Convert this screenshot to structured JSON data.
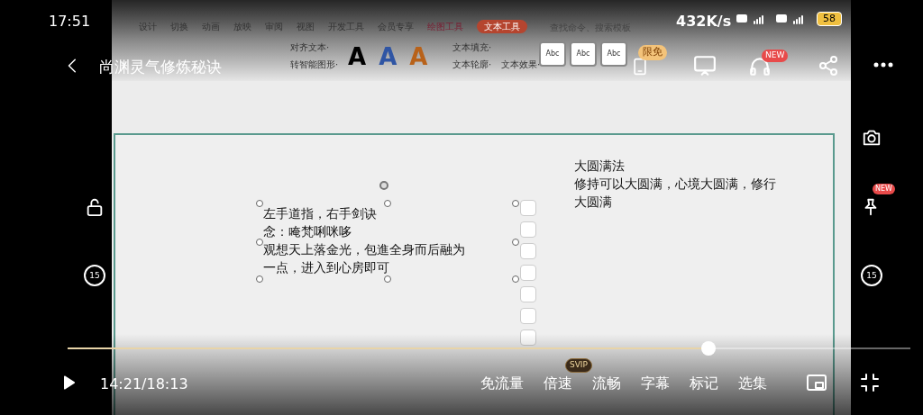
{
  "status_bar": {
    "time": "17:51",
    "network_speed": "432K/s",
    "battery": "58"
  },
  "header": {
    "title": "尚渊灵气修炼秘诀",
    "limited_badge": "限免",
    "new_badge": "NEW"
  },
  "side": {
    "replay": "15",
    "forward": "15",
    "pin_badge": "NEW"
  },
  "video_frame": {
    "ribbon_tabs": [
      {
        "label": "设计",
        "selected": false
      },
      {
        "label": "切换",
        "selected": false
      },
      {
        "label": "动画",
        "selected": false
      },
      {
        "label": "放映",
        "selected": false
      },
      {
        "label": "审阅",
        "selected": false
      },
      {
        "label": "视图",
        "selected": false
      },
      {
        "label": "开发工具",
        "selected": false
      },
      {
        "label": "会员专享",
        "selected": false
      },
      {
        "label": "绘图工具",
        "selected": false
      },
      {
        "label": "文本工具",
        "selected": true
      }
    ],
    "search": "查找命令、搜索模板",
    "ribbon_left": [
      "对齐文本·",
      "转智能图形·"
    ],
    "ribbon_text": [
      "文本填充·",
      "文本轮廓·"
    ],
    "text_effect": "文本效果·",
    "style_letters": [
      "A",
      "A",
      "A"
    ],
    "style_samples": [
      "Abc",
      "Abc",
      "Abc"
    ],
    "slide": {
      "left_box": [
        "左手道指，右手剑诀",
        "念：唵梵唎咪哆",
        "观想天上落金光，包進全身而后融为",
        "一点，进入到心房即可"
      ],
      "right_box": [
        "大圆满法",
        "修持可以大圆满，心境大圆满，修行",
        "大圆满"
      ]
    }
  },
  "player": {
    "level": 0.76,
    "time": "14:21/18:13",
    "controls": [
      {
        "label": "免流量"
      },
      {
        "label": "倍速",
        "badge": "SVIP"
      },
      {
        "label": "流畅"
      },
      {
        "label": "字幕"
      },
      {
        "label": "标记"
      },
      {
        "label": "选集"
      }
    ]
  }
}
